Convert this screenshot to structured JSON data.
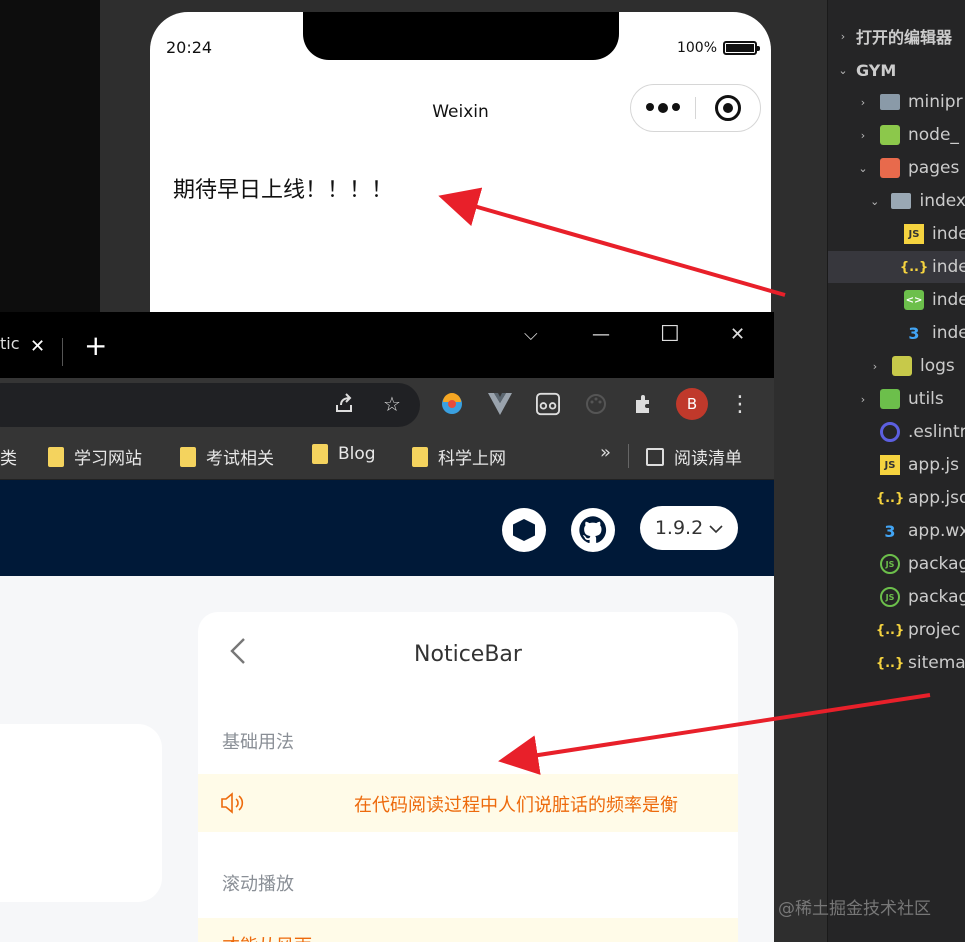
{
  "simulator": {
    "time": "20:24",
    "battery": "100%",
    "nav_title": "Weixin",
    "page_text": "期待早日上线！！！！"
  },
  "browser": {
    "tab_fragment": "tic",
    "tab_close": "✕",
    "new_tab": "+",
    "window_controls": {
      "minimize": "—",
      "maximize": "☐",
      "close": "✕",
      "dropdown": "⌵"
    },
    "profile_initial": "B",
    "bookmarks": [
      {
        "label": "类"
      },
      {
        "label": "学习网站"
      },
      {
        "label": "考试相关"
      },
      {
        "label": "Blog"
      },
      {
        "label": "科学上网"
      }
    ],
    "more": "»",
    "reading_list": "阅读清单",
    "version": "1.9.2",
    "demo": {
      "title": "NoticeBar",
      "section1": "基础用法",
      "notice_text": "在代码阅读过程中人们说脏话的频率是衡",
      "section2": "滚动播放",
      "section3_fragment": "才能从风雨",
      "notice_color": "#ed6a0c"
    }
  },
  "explorer": {
    "open_editors": "打开的编辑器",
    "root": "GYM",
    "items": [
      {
        "label": "minipr",
        "icon": "folder-icon"
      },
      {
        "label": "node_",
        "icon": "node-folder-icon"
      },
      {
        "label": "pages",
        "icon": "pages-folder-icon"
      },
      {
        "label": "index",
        "icon": "open-folder-icon"
      },
      {
        "label": "inde",
        "icon": "js-file-icon"
      },
      {
        "label": "inde",
        "icon": "json-file-icon"
      },
      {
        "label": "inde",
        "icon": "wxml-file-icon"
      },
      {
        "label": "inde",
        "icon": "wxss-file-icon"
      },
      {
        "label": "logs",
        "icon": "folder-icon"
      },
      {
        "label": "utils",
        "icon": "utils-folder-icon"
      },
      {
        "label": ".eslintr",
        "icon": "eslint-icon"
      },
      {
        "label": "app.js",
        "icon": "js-file-icon"
      },
      {
        "label": "app.jso",
        "icon": "json-file-icon"
      },
      {
        "label": "app.wx",
        "icon": "wxss-file-icon"
      },
      {
        "label": "packag",
        "icon": "npm-json-icon"
      },
      {
        "label": "packag",
        "icon": "npm-json-icon"
      },
      {
        "label": "projec",
        "icon": "json-file-icon"
      },
      {
        "label": "sitema",
        "icon": "json-file-icon"
      }
    ]
  },
  "watermark": "@稀土掘金技术社区"
}
